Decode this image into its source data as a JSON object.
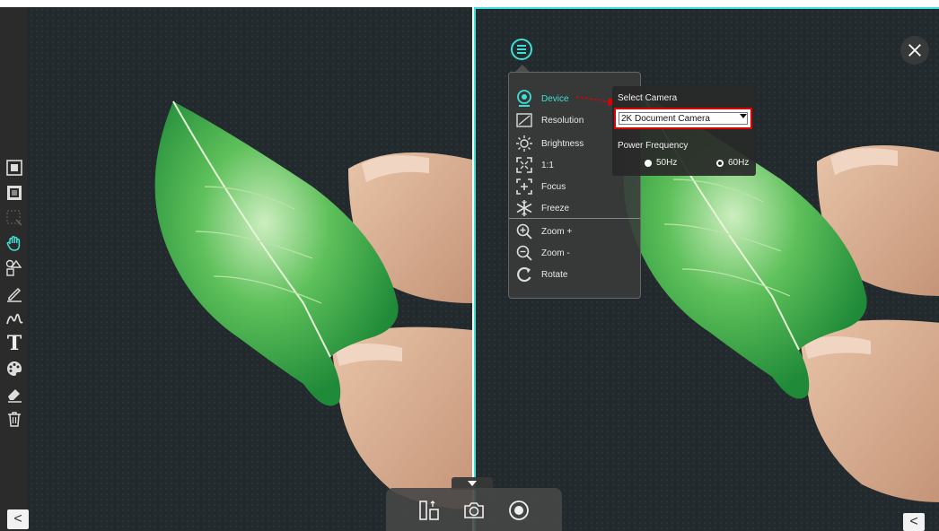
{
  "menu": {
    "items": [
      {
        "label": "Device",
        "icon": "webcam-icon",
        "active": true
      },
      {
        "label": "Resolution",
        "icon": "resolution-icon"
      },
      {
        "label": "Brightness",
        "icon": "brightness-icon"
      },
      {
        "label": "1:1",
        "icon": "fullscreen-icon"
      },
      {
        "label": "Focus",
        "icon": "focus-icon"
      },
      {
        "label": "Freeze",
        "icon": "snowflake-icon"
      },
      {
        "label": "Zoom +",
        "icon": "zoom-in-icon"
      },
      {
        "label": "Zoom -",
        "icon": "zoom-out-icon"
      },
      {
        "label": "Rotate",
        "icon": "rotate-icon"
      }
    ]
  },
  "device_panel": {
    "select_camera_label": "Select Camera",
    "camera_value": "2K Document Camera",
    "power_frequency_label": "Power Frequency",
    "options": [
      {
        "label": "50Hz",
        "selected": false
      },
      {
        "label": "60Hz",
        "selected": true
      }
    ]
  },
  "toolbar": {
    "tools": [
      "square-icon",
      "frame-icon",
      "select-area-icon",
      "hand-icon",
      "shapes-icon",
      "pencil-icon",
      "handwriting-icon",
      "text-icon",
      "palette-icon",
      "eraser-icon",
      "trash-icon"
    ],
    "text_tool_glyph": "T"
  },
  "left_collapse": "<",
  "right_collapse": "<",
  "colors": {
    "accent": "#3ee0d6",
    "highlight": "#e00000",
    "leaf": "#2aa848"
  }
}
